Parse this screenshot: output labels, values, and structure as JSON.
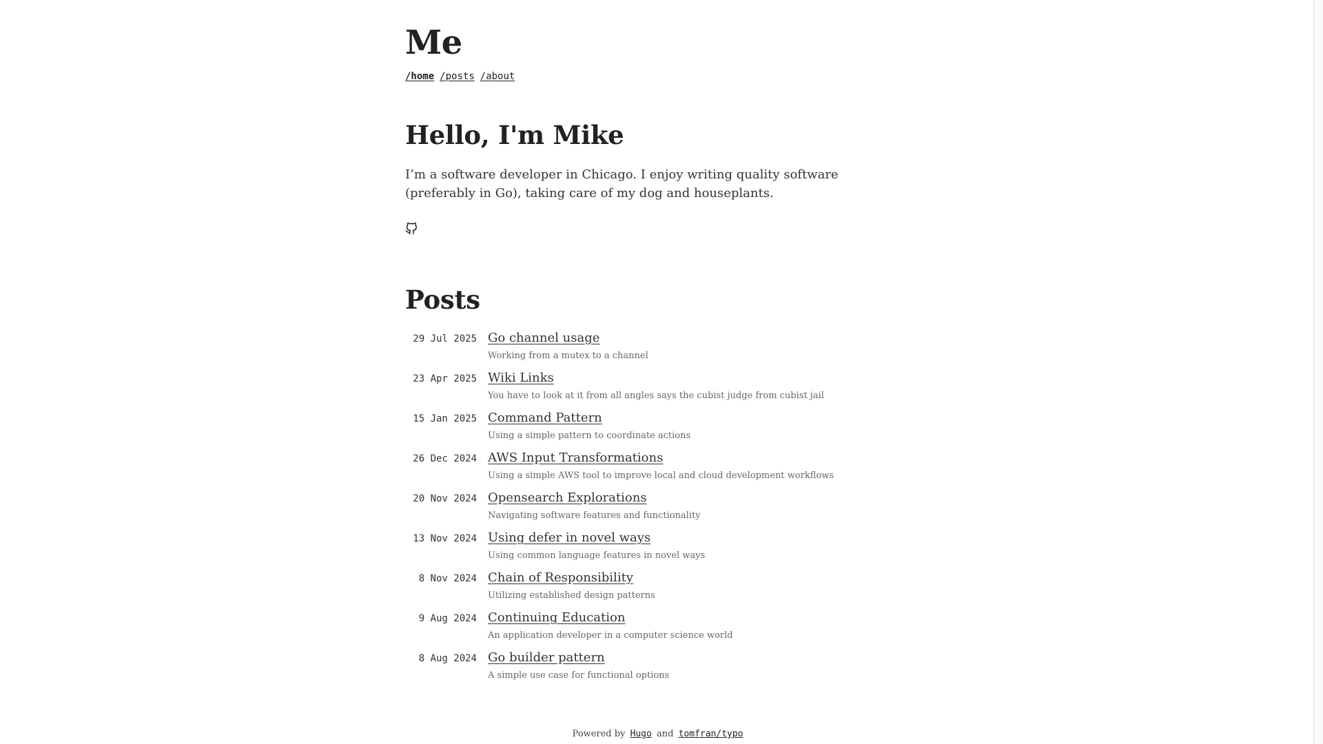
{
  "site": {
    "title": "Me"
  },
  "nav": {
    "items": [
      {
        "label": "/home",
        "active": true
      },
      {
        "label": "/posts",
        "active": false
      },
      {
        "label": "/about",
        "active": false
      }
    ]
  },
  "intro": {
    "heading": "Hello, I'm Mike",
    "bio": "I’m a software developer in Chicago. I enjoy writing quality software (preferably in Go), taking care of my dog and houseplants.",
    "social_icon": "github-icon"
  },
  "posts": {
    "heading": "Posts",
    "items": [
      {
        "date": "29 Jul 2025",
        "title": "Go channel usage",
        "description": "Working from a mutex to a channel"
      },
      {
        "date": "23 Apr 2025",
        "title": "Wiki Links",
        "description": "You have to look at it from all angles says the cubist judge from cubist jail"
      },
      {
        "date": "15 Jan 2025",
        "title": "Command Pattern",
        "description": "Using a simple pattern to coordinate actions"
      },
      {
        "date": "26 Dec 2024",
        "title": "AWS Input Transformations",
        "description": "Using a simple AWS tool to improve local and cloud development workflows"
      },
      {
        "date": "20 Nov 2024",
        "title": "Opensearch Explorations",
        "description": "Navigating software features and functionality"
      },
      {
        "date": "13 Nov 2024",
        "title": "Using defer in novel ways",
        "description": "Using common language features in novel ways"
      },
      {
        "date": "8 Nov 2024",
        "title": "Chain of Responsibility",
        "description": "Utilizing established design patterns"
      },
      {
        "date": "9 Aug 2024",
        "title": "Continuing Education",
        "description": "An application developer in a computer science world"
      },
      {
        "date": "8 Aug 2024",
        "title": "Go builder pattern",
        "description": "A simple use case for functional options"
      }
    ]
  },
  "footer": {
    "powered_by": "Powered by",
    "hugo": "Hugo",
    "and": "and",
    "theme": "tomfran/typo"
  }
}
